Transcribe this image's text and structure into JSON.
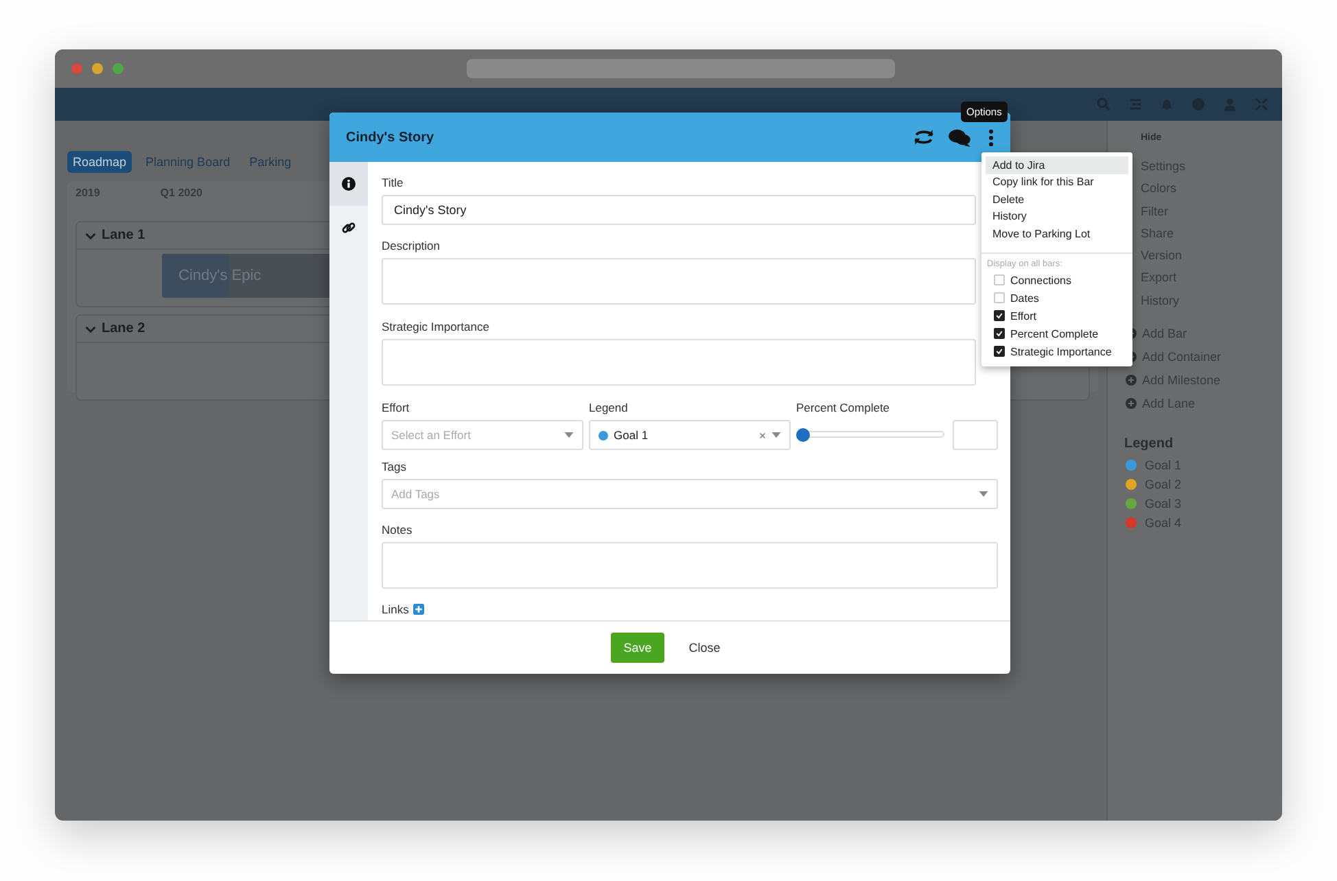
{
  "toolbar": {
    "views": [
      {
        "label": "Roadmap",
        "selected": true
      },
      {
        "label": "Planning Board",
        "selected": false
      },
      {
        "label": "Parking",
        "selected": false
      }
    ]
  },
  "timeline": {
    "periods": [
      "2019",
      "Q1 2020"
    ],
    "lanes": [
      {
        "name": "Lane 1",
        "expanded": true,
        "bars": [
          {
            "label": "Cindy's Epic",
            "level": 0.35
          }
        ]
      },
      {
        "name": "Lane 2",
        "expanded": true
      }
    ]
  },
  "sidebar": {
    "hide": "Hide",
    "menu": [
      "Settings",
      "Colors",
      "Filter",
      "Share",
      "Version",
      "Export",
      "History"
    ],
    "actions": [
      "Add Bar",
      "Add Container",
      "Add Milestone",
      "Add Lane"
    ],
    "legend": {
      "title": "Legend",
      "items": [
        {
          "label": "Goal 1",
          "color": "#3a9ad9"
        },
        {
          "label": "Goal 2",
          "color": "#e0a526"
        },
        {
          "label": "Goal 3",
          "color": "#68a73a"
        },
        {
          "label": "Goal 4",
          "color": "#d9342b"
        }
      ]
    }
  },
  "modal": {
    "title": "Cindy's Story",
    "tabs": [
      {
        "kind": "info",
        "selected": true
      },
      {
        "kind": "link",
        "selected": false
      }
    ],
    "title_field": {
      "label": "Title",
      "value": "Cindy's Story"
    },
    "description": {
      "label": "Description"
    },
    "strategic_importance": {
      "label": "Strategic Importance"
    },
    "effort": {
      "label": "Effort",
      "placeholder": "Select an Effort"
    },
    "legend": {
      "label": "Legend",
      "value": "Goal 1",
      "color": "#3a9ad9"
    },
    "percent_complete": {
      "label": "Percent Complete",
      "level": 0
    },
    "tags": {
      "label": "Tags",
      "placeholder": "Add Tags"
    },
    "notes": {
      "label": "Notes"
    },
    "links": {
      "label": "Links"
    },
    "buttons": [
      "Save",
      "Close"
    ]
  },
  "tooltip": "Options",
  "options_menu": {
    "items": [
      {
        "label": "Add to Jira",
        "selected": true
      },
      {
        "label": "Copy link for this Bar",
        "selected": false
      },
      {
        "label": "Delete",
        "selected": false
      },
      {
        "label": "History",
        "selected": false
      },
      {
        "label": "Move to Parking Lot",
        "selected": false
      }
    ],
    "section": "Display on all bars:",
    "options": [
      {
        "label": "Connections",
        "checked": false
      },
      {
        "label": "Dates",
        "checked": false
      },
      {
        "label": "Effort",
        "checked": true
      },
      {
        "label": "Percent Complete",
        "checked": true
      },
      {
        "label": "Strategic Importance",
        "checked": true
      }
    ]
  }
}
